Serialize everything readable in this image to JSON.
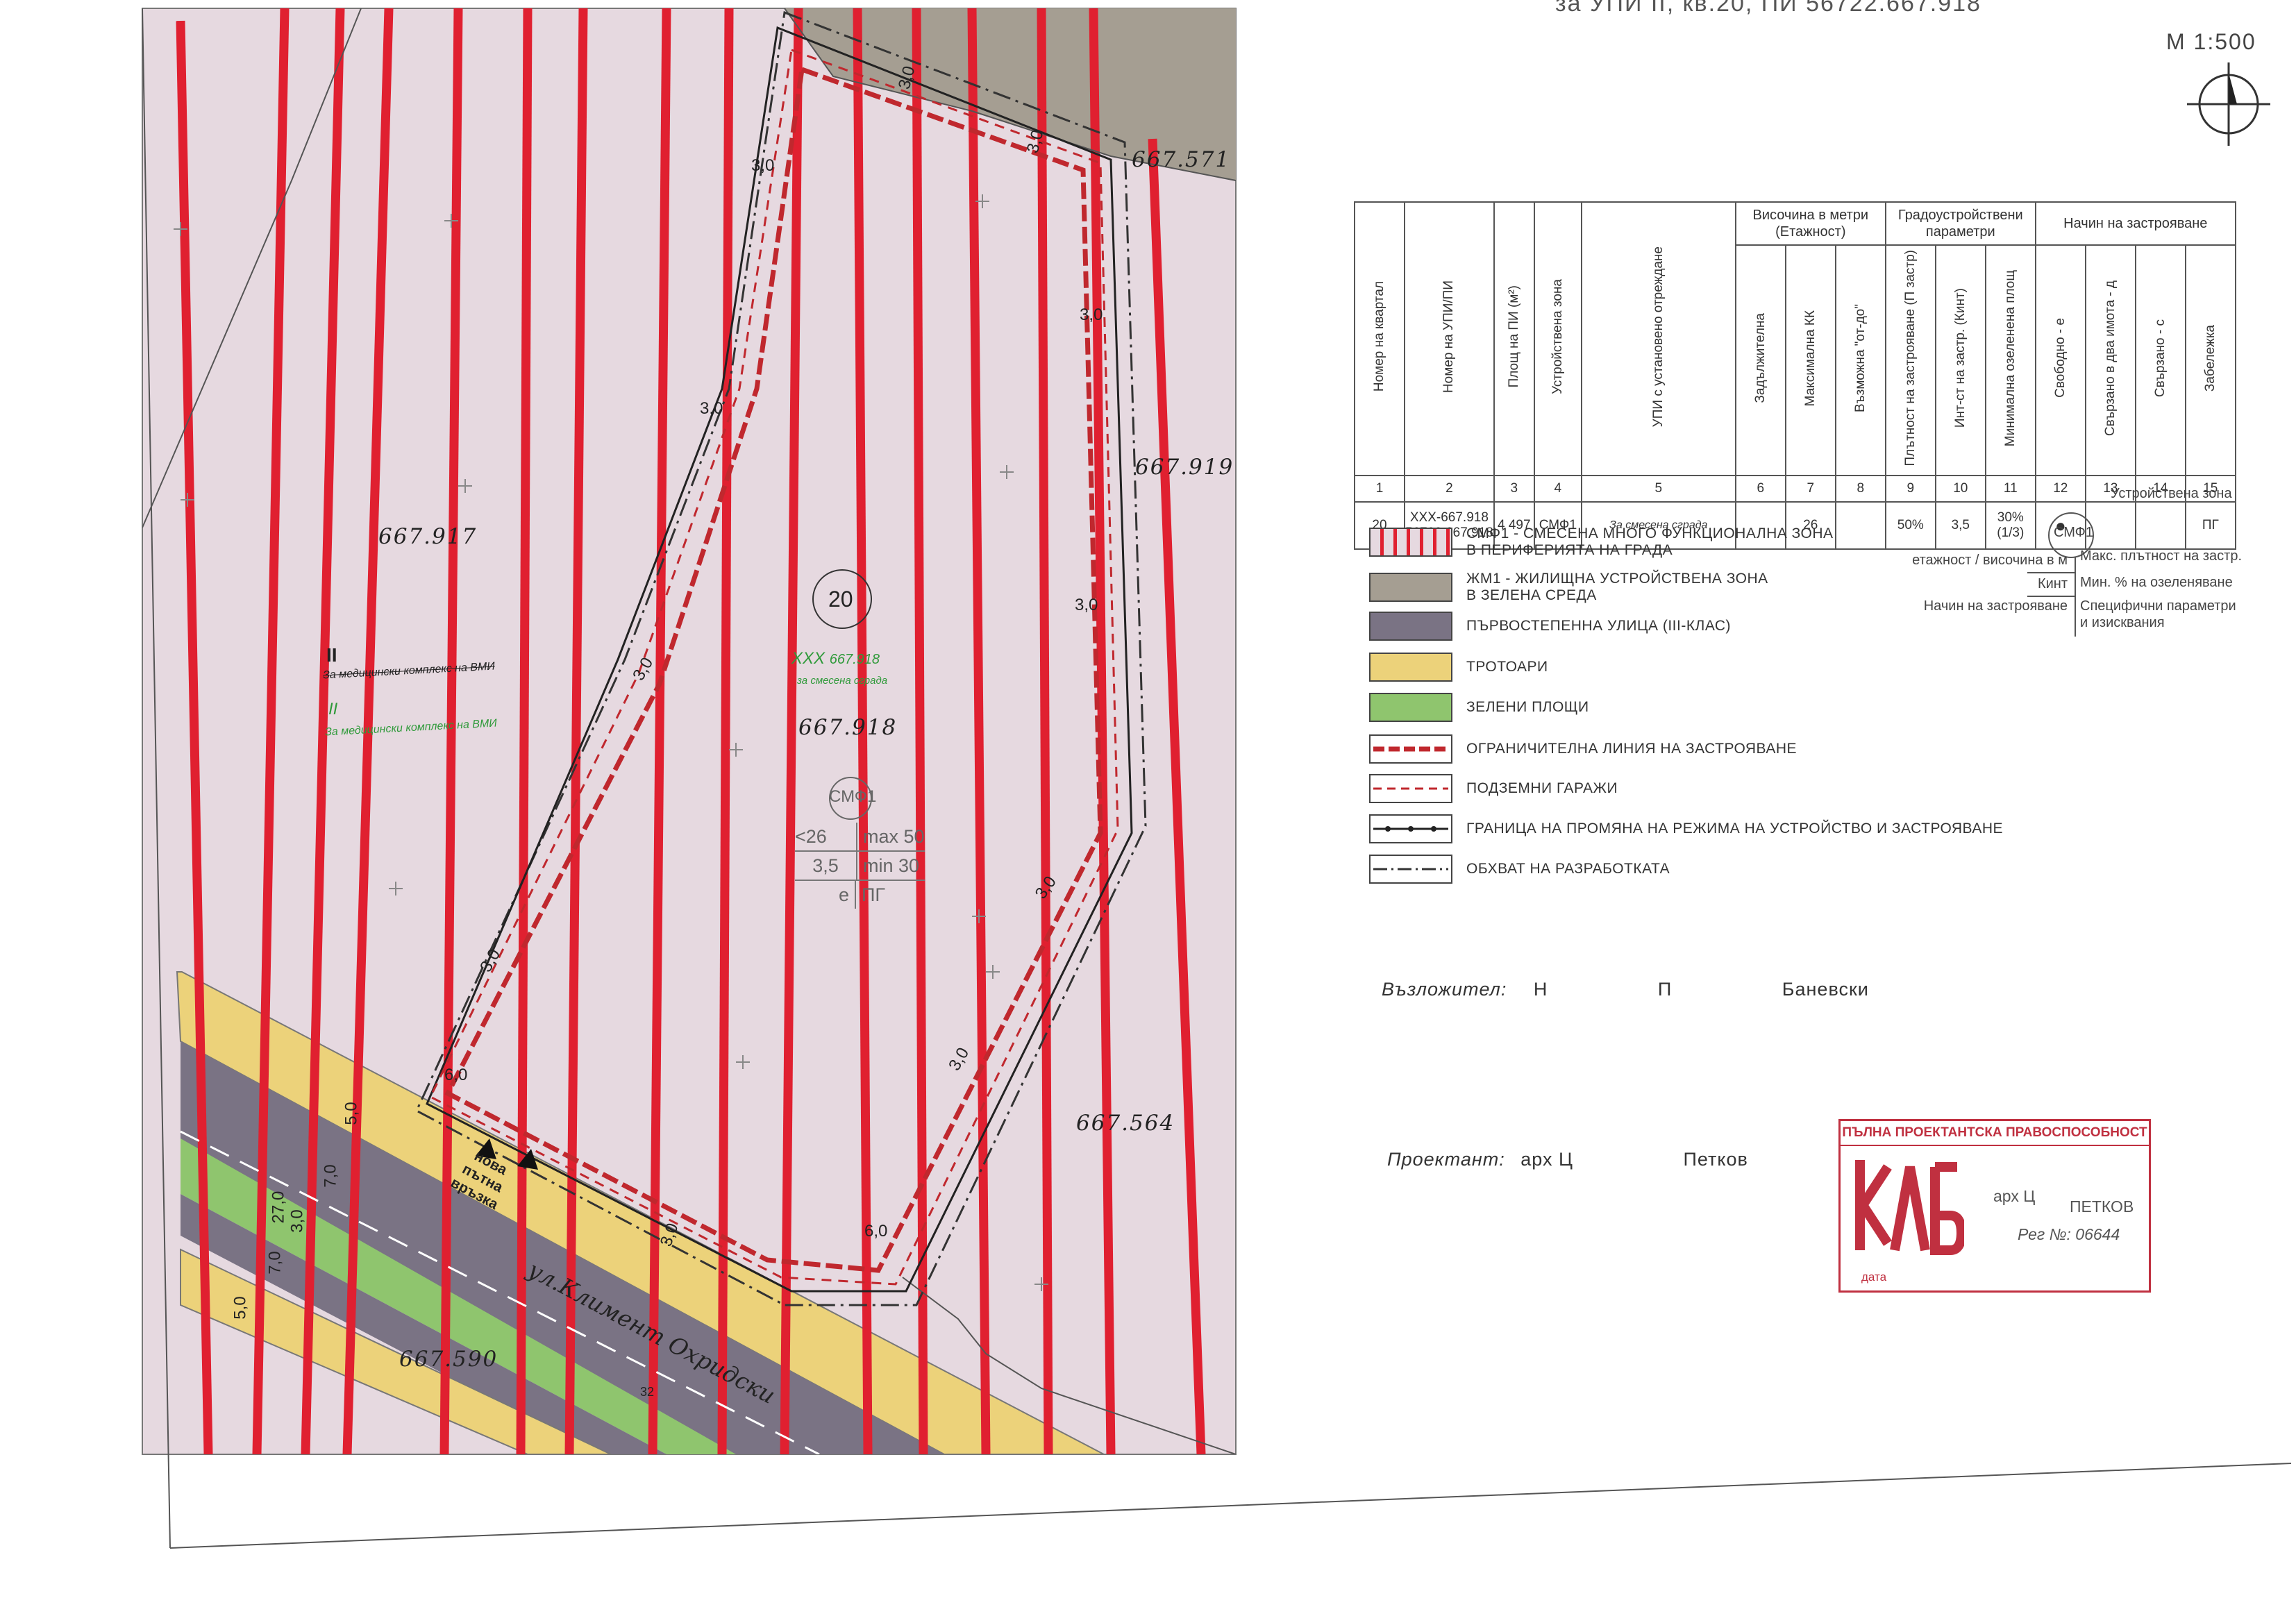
{
  "header": {
    "title_fragment": "за УПИ II, кв.20, ПИ 56722.667.918",
    "scale": "М 1:500"
  },
  "map": {
    "parcels": [
      {
        "id": "667.571"
      },
      {
        "id": "667.919"
      },
      {
        "id": "667.917"
      },
      {
        "id": "667.918"
      },
      {
        "id": "667.564"
      },
      {
        "id": "667.590"
      }
    ],
    "block_number": "20",
    "upi_old": {
      "roman": "II",
      "purpose": "За медицински комплекс на ВМИ"
    },
    "upi_new": {
      "roman": "II",
      "purpose": "За медицински комплекс на ВМИ"
    },
    "upi_xxx": {
      "label": "XXX",
      "parcel": "667.918",
      "purpose": "за смесена сграда"
    },
    "zone_label": "СМФ1",
    "zone_params": {
      "floors": "<26",
      "density": "max 50",
      "kint": "3,5",
      "green": "min 30",
      "build_mode": "е",
      "notes": "ПГ"
    },
    "distances": [
      "3,0",
      "3,0",
      "3,0",
      "3,0",
      "3,0",
      "3,0",
      "3,0",
      "3,0",
      "3,0",
      "3,0",
      "3,0",
      "6,0",
      "6,0"
    ],
    "street_dims": [
      "5,0",
      "7,0",
      "27,0",
      "3,0",
      "7,0",
      "5,0"
    ],
    "new_road_label": "нова пътна връзка",
    "street_name": "ул.Климент Охридски",
    "height_mark": "32"
  },
  "table": {
    "group_headers": {
      "height": "Височина в метри (Етажност)",
      "params": "Градоустройствени параметри",
      "build": "Начин на застрояване"
    },
    "columns": [
      "Номер на квартал",
      "Номер на УПИ/ПИ",
      "Площ на ПИ (м²)",
      "Устройствена зона",
      "УПИ с установено отреждане",
      "Задължителна",
      "Максимална КК",
      "Възможна \"от-до\"",
      "Плътност на застрояване (П застр)",
      "Инт-ст на застр. (Кинт)",
      "Минимална озеленена площ",
      "Свободно - е",
      "Свързано в два имота - д",
      "Свързано - с",
      "Забележка"
    ],
    "numbers": [
      "1",
      "2",
      "3",
      "4",
      "5",
      "6",
      "7",
      "8",
      "9",
      "10",
      "11",
      "12",
      "13",
      "14",
      "15"
    ],
    "row": {
      "block": "20",
      "upi": "XXX-667.918",
      "pi": "56722.667.918",
      "area": "4 497",
      "zone": "СМФ1",
      "purpose": "За смесена сграда",
      "mandatory": "",
      "max_kk": "26",
      "possible": "",
      "density": "50%",
      "kint": "3,5",
      "green": "30%",
      "green_sub": "(1/3)",
      "free": "●",
      "two": "",
      "linked": "",
      "note": "ПГ"
    }
  },
  "legend": [
    {
      "key": "smf",
      "text": "СМФ1 - СМЕСЕНА МНОГО ФУНКЦИОНАЛНА ЗОНА",
      "text2": "В ПЕРИФЕРИЯТА НА ГРАДА"
    },
    {
      "key": "jm",
      "text": "ЖМ1 - ЖИЛИЩНА УСТРОЙСТВЕНА ЗОНА",
      "text2": "В ЗЕЛЕНА СРЕДА"
    },
    {
      "key": "street",
      "text": "ПЪРВОСТЕПЕННА УЛИЦА (III-КЛАС)",
      "text2": ""
    },
    {
      "key": "sidewalk",
      "text": "ТРОТОАРИ",
      "text2": ""
    },
    {
      "key": "green",
      "text": "ЗЕЛЕНИ ПЛОЩИ",
      "text2": ""
    },
    {
      "key": "limit",
      "text": "ОГРАНИЧИТЕЛНА ЛИНИЯ НА ЗАСТРОЯВАНЕ",
      "text2": ""
    },
    {
      "key": "garage",
      "text": "ПОДЗЕМНИ ГАРАЖИ",
      "text2": ""
    },
    {
      "key": "change",
      "text": "ГРАНИЦА НА ПРОМЯНА НА РЕЖИМА НА УСТРОЙСТВО И ЗАСТРОЯВАНЕ",
      "text2": ""
    },
    {
      "key": "scope",
      "text": "ОБХВАТ НА РАЗРАБОТКАТА",
      "text2": ""
    }
  ],
  "key_diagram": {
    "zone_title": "Устройствена зона",
    "zone": "СМФ1",
    "left1": "етажност / височина в м",
    "right1": "Макс. плътност на застр.",
    "left2": "Кинт",
    "right2": "Мин. % на озеленяване",
    "left3": "Начин на застрояване",
    "right3": "Специфични параметри",
    "right3b": "и изисквания"
  },
  "signatures": {
    "client_label": "Възложител:",
    "client_a": "Н",
    "client_b": "П",
    "client_name": "Баневски",
    "designer_label": "Проектант:",
    "designer_title": "арх Ц",
    "designer_name": "Петков"
  },
  "stamp": {
    "header": "ПЪЛНА ПРОЕКТАНТСКА ПРАВОСПОСОБНОСТ",
    "title": "арх Ц",
    "name": "ПЕТКОВ",
    "reg": "Рег №: 06644",
    "date": "дата"
  },
  "colors": {
    "smf_fill": "#e6d9e0",
    "stripe": "#e02030",
    "jm_fill": "#a59e92",
    "street": "#7a7384",
    "sidewalk": "#ecd27a",
    "green": "#8fc56e",
    "limit": "#c0282e",
    "stamp": "#c03040"
  }
}
